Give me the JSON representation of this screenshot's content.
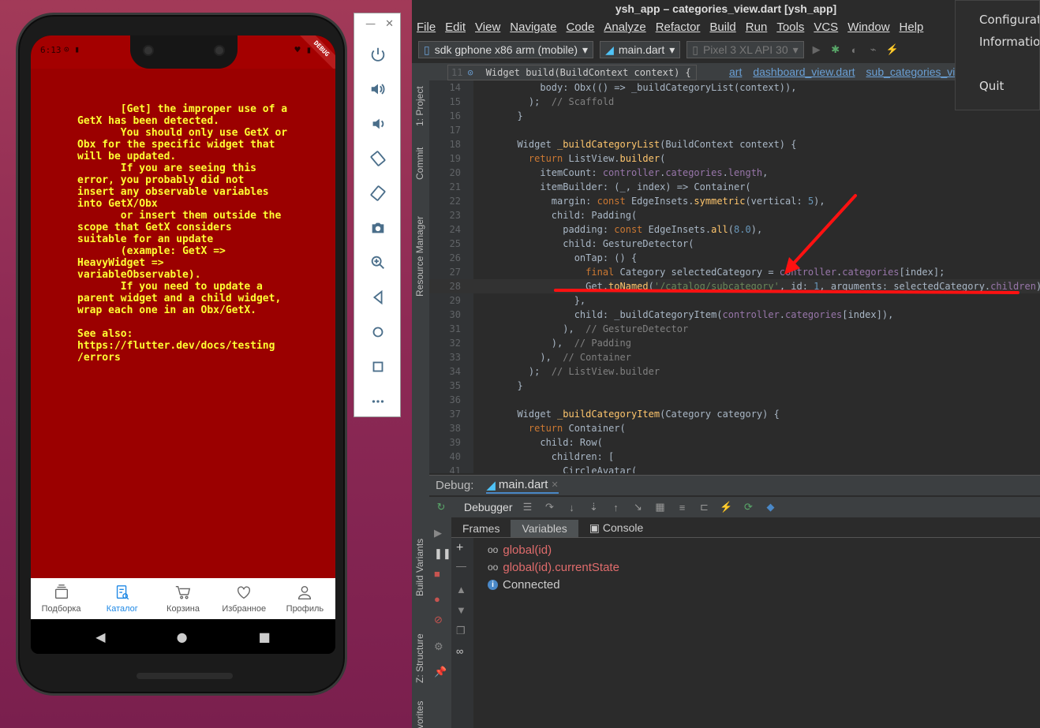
{
  "phone": {
    "status_time": "6:13",
    "status_icons": "⊙ ▮",
    "status_right": "♥ ▮",
    "debug_banner": "DEBUG",
    "error_text": "       [Get] the improper use of a\nGetX has been detected.\n       You should only use GetX or\nObx for the specific widget that\nwill be updated.\n       If you are seeing this\nerror, you probably did not\ninsert any observable variables\ninto GetX/Obx\n       or insert them outside the\nscope that GetX considers\nsuitable for an update\n       (example: GetX =>\nHeavyWidget =>\nvariableObservable).\n       If you need to update a\nparent widget and a child widget,\nwrap each one in an Obx/GetX.\n\nSee also:\nhttps://flutter.dev/docs/testing\n/errors",
    "nav": [
      {
        "label": "Подборка",
        "icon": "cards-icon"
      },
      {
        "label": "Каталог",
        "icon": "catalog-icon",
        "active": true
      },
      {
        "label": "Корзина",
        "icon": "cart-icon"
      },
      {
        "label": "Избранное",
        "icon": "heart-icon"
      },
      {
        "label": "Профиль",
        "icon": "person-icon"
      }
    ],
    "sys_back": "◀",
    "sys_home": "●",
    "sys_recent": "■",
    "error_bg": "#9b0000",
    "error_fg": "#ffff33",
    "accent": "#1e88e5"
  },
  "emulator": {
    "minimize": "—",
    "close": "✕",
    "buttons": [
      "power-icon",
      "volume-up-icon",
      "volume-down-icon",
      "rotate-left-icon",
      "rotate-right-icon",
      "camera-icon",
      "zoom-icon",
      "back-icon",
      "home-icon",
      "overview-icon",
      "more-icon"
    ]
  },
  "ide": {
    "title": "ysh_app – categories_view.dart [ysh_app]",
    "menu": [
      "File",
      "Edit",
      "View",
      "Navigate",
      "Code",
      "Analyze",
      "Refactor",
      "Build",
      "Run",
      "Tools",
      "VCS",
      "Window",
      "Help"
    ],
    "device_combo": "sdk gphone x86 arm (mobile)",
    "run_config": "main.dart",
    "avd_combo": "Pixel 3 XL API 30",
    "side_tabs": [
      "1: Project",
      "Commit",
      "Resource Manager",
      "Build Variants",
      "Z: Structure",
      "Favorites"
    ],
    "editor_tabs": [
      "art",
      "dashboard_view.dart",
      "sub_categories_view.dart"
    ],
    "breadcrumb_line": "11",
    "breadcrumb_text": "Widget build(BuildContext context) {",
    "lines": [
      {
        "n": "14",
        "html": "      <span class=\"cls\">body: Obx(() => _buildCategoryList(context)),</span>"
      },
      {
        "n": "15",
        "html": "    );  <span class=\"cmt\">// Scaffold</span>"
      },
      {
        "n": "16",
        "html": "  }"
      },
      {
        "n": "17",
        "html": ""
      },
      {
        "n": "18",
        "html": "  <span class=\"cls\">Widget</span> <span class=\"fn\">_buildCategoryList</span>(BuildContext context) {"
      },
      {
        "n": "19",
        "html": "    <span class=\"kw\">return</span> ListView.<span class=\"fn\">builder</span>("
      },
      {
        "n": "20",
        "html": "      itemCount: <span class=\"fld\">controller</span>.<span class=\"fld\">categories</span>.<span class=\"fld\">length</span>,"
      },
      {
        "n": "21",
        "html": "      itemBuilder: (_, index) => Container("
      },
      {
        "n": "22",
        "html": "        margin: <span class=\"kw\">const</span> EdgeInsets.<span class=\"fn\">symmetric</span>(vertical: <span class=\"num\">5</span>),"
      },
      {
        "n": "23",
        "html": "        child: Padding("
      },
      {
        "n": "24",
        "html": "          padding: <span class=\"kw\">const</span> EdgeInsets.<span class=\"fn\">all</span>(<span class=\"num\">8.0</span>),"
      },
      {
        "n": "25",
        "html": "          child: GestureDetector("
      },
      {
        "n": "26",
        "html": "            onTap: () {"
      },
      {
        "n": "27",
        "html": "              <span class=\"kw\">final</span> Category selectedCategory = <span class=\"fld\">controller</span>.<span class=\"fld\">categories</span>[index];"
      },
      {
        "n": "28",
        "html": "              Get.<span class=\"fn\">toNamed</span>(<span class=\"str\">'/catalog/subcategory'</span>, id: <span class=\"num\">1</span>, arguments: selectedCategory.<span class=\"fld\">children</span>);"
      },
      {
        "n": "29",
        "html": "            },"
      },
      {
        "n": "30",
        "html": "            child: _buildCategoryItem(<span class=\"fld\">controller</span>.<span class=\"fld\">categories</span>[index]),"
      },
      {
        "n": "31",
        "html": "          ),  <span class=\"cmt\">// GestureDetector</span>"
      },
      {
        "n": "32",
        "html": "        ),  <span class=\"cmt\">// Padding</span>"
      },
      {
        "n": "33",
        "html": "      ),  <span class=\"cmt\">// Container</span>"
      },
      {
        "n": "34",
        "html": "    );  <span class=\"cmt\">// ListView.builder</span>"
      },
      {
        "n": "35",
        "html": "  }"
      },
      {
        "n": "36",
        "html": ""
      },
      {
        "n": "37",
        "html": "  <span class=\"cls\">Widget</span> <span class=\"fn\">_buildCategoryItem</span>(Category category) {"
      },
      {
        "n": "38",
        "html": "    <span class=\"kw\">return</span> Container("
      },
      {
        "n": "39",
        "html": "      child: Row("
      },
      {
        "n": "40",
        "html": "        children: ["
      },
      {
        "n": "41",
        "html": "          CircleAvatar("
      }
    ],
    "debug_label": "Debug:",
    "debug_tab": "main.dart",
    "debugger_label": "Debugger",
    "subtabs": [
      "Frames",
      "Variables",
      "Console"
    ],
    "vars": [
      {
        "text": "global(id)",
        "kind": "err"
      },
      {
        "text": "global(id).currentState",
        "kind": "err"
      },
      {
        "text": "Connected",
        "kind": "info"
      }
    ]
  },
  "context_menu": [
    "Configuration",
    "Information",
    "",
    "Quit"
  ]
}
